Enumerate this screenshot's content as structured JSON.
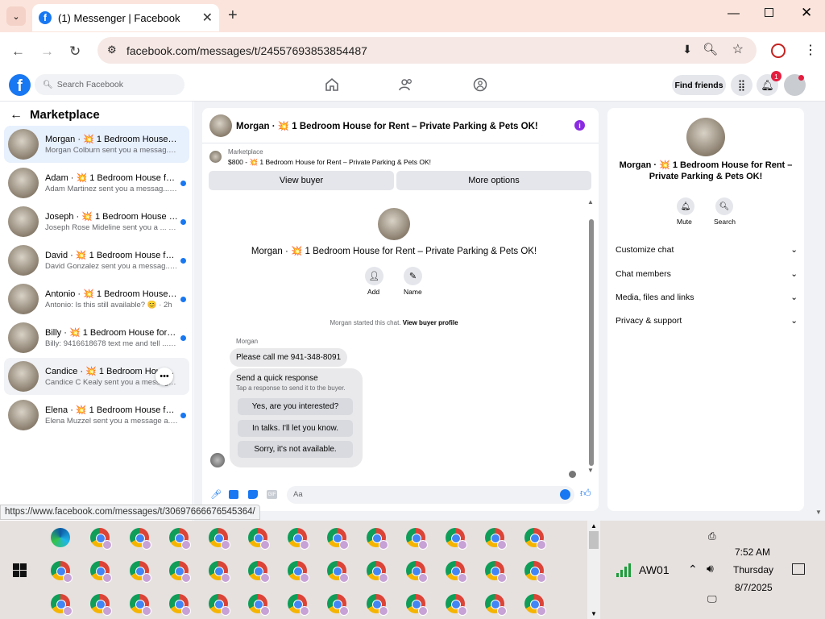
{
  "browser": {
    "tab_title": "(1) Messenger | Facebook",
    "url": "facebook.com/messages/t/24557693853854487",
    "new_tab": "+"
  },
  "fb": {
    "search_placeholder": "Search Facebook",
    "find_friends": "Find friends",
    "notification_count": "1"
  },
  "sidebar": {
    "title": "Marketplace",
    "conversations": [
      {
        "title": "Morgan · 💥 1 Bedroom House for...",
        "preview": "Morgan Colburn sent you a messag...",
        "time": "· 29m",
        "unread": false
      },
      {
        "title": "Adam · 💥 1 Bedroom House for ...",
        "preview": "Adam Martinez sent you a messag...",
        "time": "· 1h",
        "unread": true
      },
      {
        "title": "Joseph · 💥 1 Bedroom House fo...",
        "preview": "Joseph Rose Mideline sent you a ...",
        "time": "· 1h",
        "unread": true
      },
      {
        "title": "David · 💥 1 Bedroom House for ...",
        "preview": "David Gonzalez sent you a messag...",
        "time": "· 2h",
        "unread": true
      },
      {
        "title": "Antonio · 💥 1 Bedroom House f...",
        "preview": "Antonio: Is this still available? 😊",
        "time": "· 2h",
        "unread": true
      },
      {
        "title": "Billy · 💥 1 Bedroom House for R...",
        "preview": "Billy: 9416618678 text me and tell ...",
        "time": "· 3h",
        "unread": true
      },
      {
        "title": "Candice · 💥 1 Bedroom House ...",
        "preview": "Candice C Kealy sent you a message",
        "time": "· 4h",
        "unread": false
      },
      {
        "title": "Elena · 💥 1 Bedroom House for ...",
        "preview": "Elena Muzzel sent you a message a...",
        "time": "· 4h",
        "unread": true
      }
    ]
  },
  "chat": {
    "header_title": "Morgan · 💥 1 Bedroom House for Rent – Private Parking & Pets OK!",
    "listing_label": "Marketplace",
    "listing_text": "$800 - 💥 1 Bedroom House for Rent – Private Parking & Pets OK!",
    "view_buyer": "View buyer",
    "more_options": "More options",
    "profile_title": "Morgan · 💥 1 Bedroom House for Rent – Private Parking & Pets OK!",
    "add_label": "Add",
    "name_label": "Name",
    "started_text": "Morgan started this chat.",
    "view_profile": "View buyer profile",
    "sender": "Morgan",
    "message": "Please call me 941-348-8091",
    "quick_title": "Send a quick response",
    "quick_sub": "Tap a response to send it to the buyer.",
    "quick_replies": [
      "Yes, are you interested?",
      "In talks. I'll let you know.",
      "Sorry, it's not available."
    ],
    "input_placeholder": "Aa"
  },
  "info": {
    "title": "Morgan · 💥 1 Bedroom House for Rent – Private Parking & Pets OK!",
    "mute": "Mute",
    "search": "Search",
    "sections": [
      "Customize chat",
      "Chat members",
      "Media, files and links",
      "Privacy & support"
    ]
  },
  "status_url": "https://www.facebook.com/messages/t/30697666676545364/",
  "taskbar": {
    "network": "AW01",
    "time": "7:52 AM",
    "day": "Thursday",
    "date": "8/7/2025"
  },
  "colors": {
    "fb_blue": "#1877f2",
    "chrome_bg": "#fbe4dc",
    "purple_info": "#8a2be2"
  }
}
